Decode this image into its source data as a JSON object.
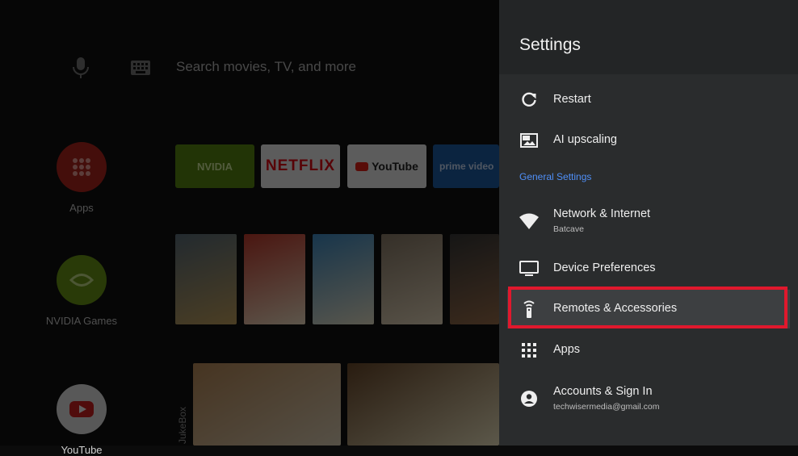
{
  "home": {
    "search_placeholder": "Search movies, TV, and more",
    "left_apps": [
      {
        "label": "Apps"
      },
      {
        "label": "NVIDIA Games"
      },
      {
        "label": "YouTube"
      }
    ],
    "app_tiles": [
      {
        "label": "NVIDIA"
      },
      {
        "label": "NETFLIX"
      },
      {
        "label": "YouTube"
      },
      {
        "label": "prime video"
      }
    ],
    "row_label": "JukeBox"
  },
  "settings": {
    "title": "Settings",
    "section_general": "General Settings",
    "items": [
      {
        "label": "Restart",
        "icon": "restart-icon"
      },
      {
        "label": "AI upscaling",
        "icon": "picture-in-picture-icon"
      },
      {
        "label": "Network & Internet",
        "sublabel": "Batcave",
        "icon": "wifi-icon"
      },
      {
        "label": "Device Preferences",
        "icon": "tv-icon"
      },
      {
        "label": "Remotes & Accessories",
        "icon": "remote-icon"
      },
      {
        "label": "Apps",
        "icon": "apps-grid-icon"
      },
      {
        "label": "Accounts & Sign In",
        "sublabel": "techwisermedia@gmail.com",
        "icon": "account-icon"
      }
    ]
  },
  "colors": {
    "panel_bg": "#2a2c2d",
    "header_bg": "#232526",
    "accent_blue": "#4f8ff7",
    "highlight_red": "#e0182d"
  }
}
